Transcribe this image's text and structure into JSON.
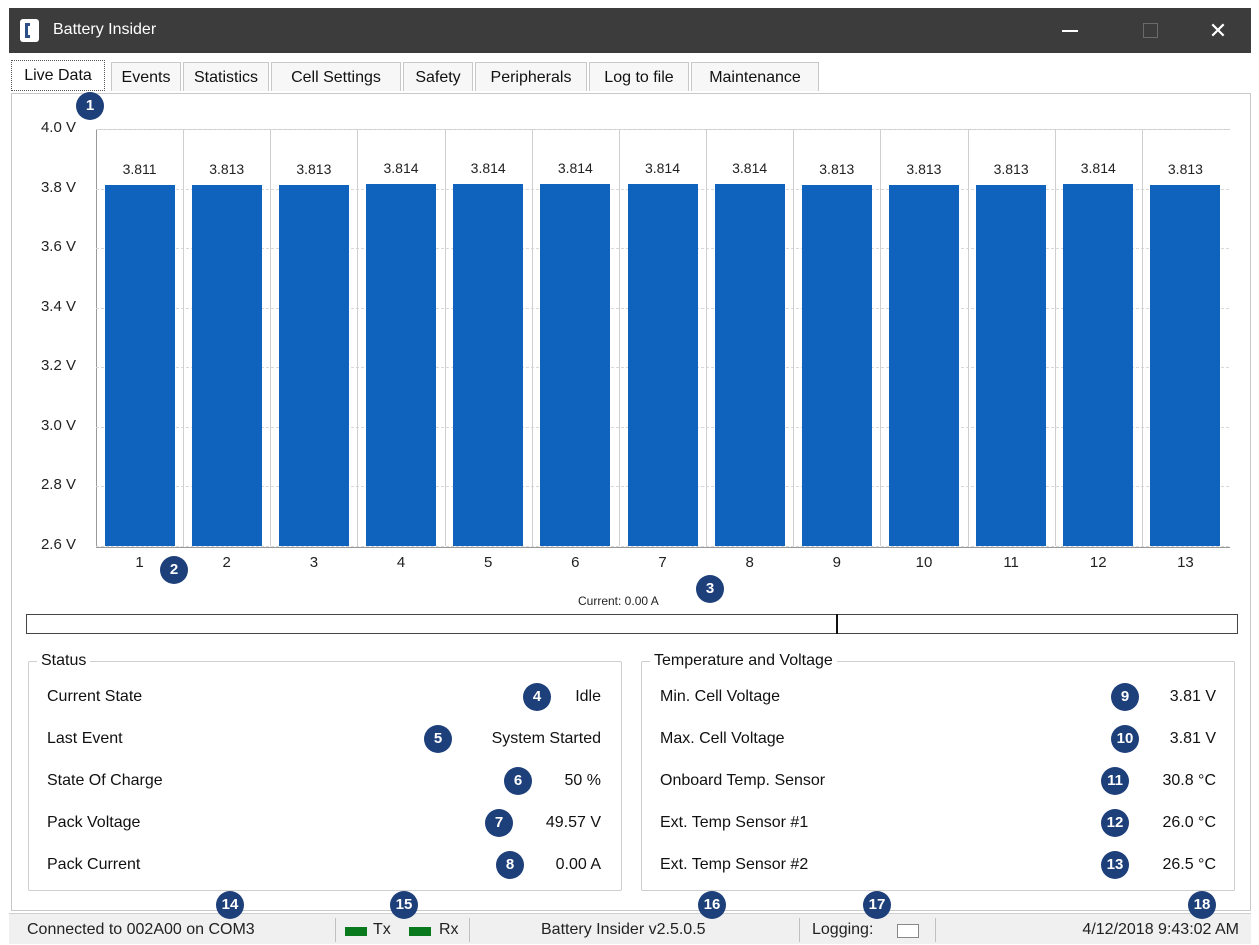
{
  "window": {
    "title": "Battery Insider"
  },
  "tabs": [
    "Live Data",
    "Events",
    "Statistics",
    "Cell Settings",
    "Safety",
    "Peripherals",
    "Log to file",
    "Maintenance"
  ],
  "chart_data": {
    "type": "bar",
    "categories": [
      "1",
      "2",
      "3",
      "4",
      "5",
      "6",
      "7",
      "8",
      "9",
      "10",
      "11",
      "12",
      "13"
    ],
    "values": [
      3.811,
      3.813,
      3.813,
      3.814,
      3.814,
      3.814,
      3.814,
      3.814,
      3.813,
      3.813,
      3.813,
      3.814,
      3.813
    ],
    "data_labels": [
      "3.811",
      "3.813",
      "3.813",
      "3.814",
      "3.814",
      "3.814",
      "3.814",
      "3.814",
      "3.813",
      "3.813",
      "3.813",
      "3.814",
      "3.813"
    ],
    "y_ticks": [
      "4.0 V",
      "3.8 V",
      "3.6 V",
      "3.4 V",
      "3.2 V",
      "3.0 V",
      "2.8 V",
      "2.6 V"
    ],
    "ylim": [
      2.6,
      4.0
    ],
    "bar_color": "#0f63bd",
    "grid": true
  },
  "current": {
    "label": "Current: 0.00 A",
    "value": 0.0
  },
  "status": {
    "title": "Status",
    "rows": [
      {
        "label": "Current State",
        "value": "Idle"
      },
      {
        "label": "Last Event",
        "value": "System Started"
      },
      {
        "label": "State Of Charge",
        "value": "50 %"
      },
      {
        "label": "Pack Voltage",
        "value": "49.57 V"
      },
      {
        "label": "Pack Current",
        "value": "0.00 A"
      }
    ]
  },
  "temp_voltage": {
    "title": "Temperature and Voltage",
    "rows": [
      {
        "label": "Min. Cell Voltage",
        "value": "3.81 V"
      },
      {
        "label": "Max. Cell Voltage",
        "value": "3.81 V"
      },
      {
        "label": "Onboard Temp. Sensor",
        "value": "30.8 °C"
      },
      {
        "label": "Ext. Temp Sensor #1",
        "value": "26.0 °C"
      },
      {
        "label": "Ext. Temp Sensor #2",
        "value": "26.5 °C"
      }
    ]
  },
  "statusbar": {
    "connection": "Connected to 002A00 on COM3",
    "tx": "Tx",
    "rx": "Rx",
    "version": "Battery Insider v2.5.0.5",
    "logging": "Logging:",
    "datetime": "4/12/2018 9:43:02 AM",
    "led_color": "#0a7a1e"
  },
  "callouts": [
    "1",
    "2",
    "3",
    "4",
    "5",
    "6",
    "7",
    "8",
    "9",
    "10",
    "11",
    "12",
    "13",
    "14",
    "15",
    "16",
    "17",
    "18"
  ],
  "icons": {
    "app": "battery-insider-logo-icon",
    "minimize": "minimize-icon",
    "maximize": "maximize-icon",
    "close": "close-icon"
  }
}
